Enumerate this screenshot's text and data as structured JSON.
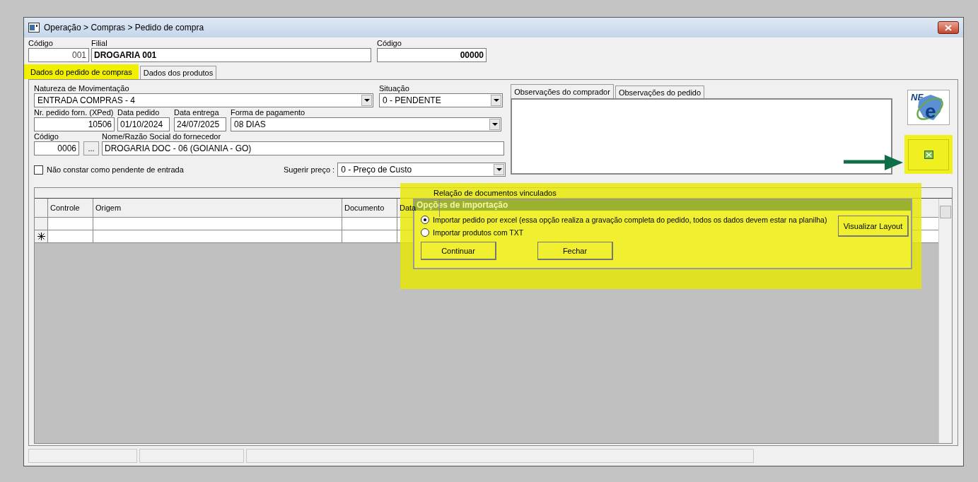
{
  "window": {
    "title": "Operação > Compras > Pedido de compra"
  },
  "header": {
    "codigo": {
      "label": "Código",
      "value": "001"
    },
    "filial": {
      "label": "Filial",
      "value": "DROGARIA 001"
    },
    "codigo_pedido": {
      "label": "Código",
      "value": "00000"
    }
  },
  "tabs": [
    {
      "label": "Dados do pedido de compras",
      "selected": true,
      "highlighted": true
    },
    {
      "label": "Dados dos produtos",
      "selected": false,
      "highlighted": false
    }
  ],
  "form": {
    "natureza": {
      "label": "Natureza de Movimentação",
      "value": "ENTRADA COMPRAS - 4"
    },
    "situacao": {
      "label": "Situação",
      "value": "0 - PENDENTE"
    },
    "nr_pedido": {
      "label": "Nr. pedido forn. (XPed)",
      "value": "10506"
    },
    "data_pedido": {
      "label": "Data pedido",
      "value": "01/10/2024"
    },
    "data_entrega": {
      "label": "Data entrega",
      "value": "24/07/2025"
    },
    "forma_pagamento": {
      "label": "Forma de pagamento",
      "value": "08 DIAS"
    },
    "fornecedor_codigo": {
      "label": "Código",
      "value": "0006"
    },
    "browse_button": "...",
    "fornecedor_nome": {
      "label": "Nome/Razão Social do fornecedor",
      "value": "DROGARIA DOC - 06 (GOIANIA - GO)"
    },
    "pendente": {
      "label": "Não constar como pendente de entrada",
      "checked": false
    },
    "sugerir_preco": {
      "label": "Sugerir preço :",
      "value": "0 - Preço de Custo"
    }
  },
  "observation_tabs": [
    {
      "label": "Observações do comprador",
      "selected": true
    },
    {
      "label": "Observações do pedido",
      "selected": false
    }
  ],
  "nfe_button": {
    "top": "NF",
    "mark": "e"
  },
  "excel_button": {
    "highlighted": true
  },
  "grid": {
    "title": "Relação de documentos vinculados",
    "columns": [
      "Controle",
      "Origem",
      "Documento",
      "Data"
    ],
    "rows": [
      {
        "new": false
      },
      {
        "new": true
      }
    ]
  },
  "dialog": {
    "title": "Opções de importação",
    "highlighted": true,
    "options": [
      {
        "label": "Importar pedido por excel (essa opção realiza a gravação completa do pedido, todos os dados devem estar na planilha)",
        "selected": true
      },
      {
        "label": "Importar produtos com TXT",
        "selected": false
      }
    ],
    "layout_button": "Visualizar Layout",
    "buttons": [
      "Continuar",
      "Fechar"
    ]
  }
}
